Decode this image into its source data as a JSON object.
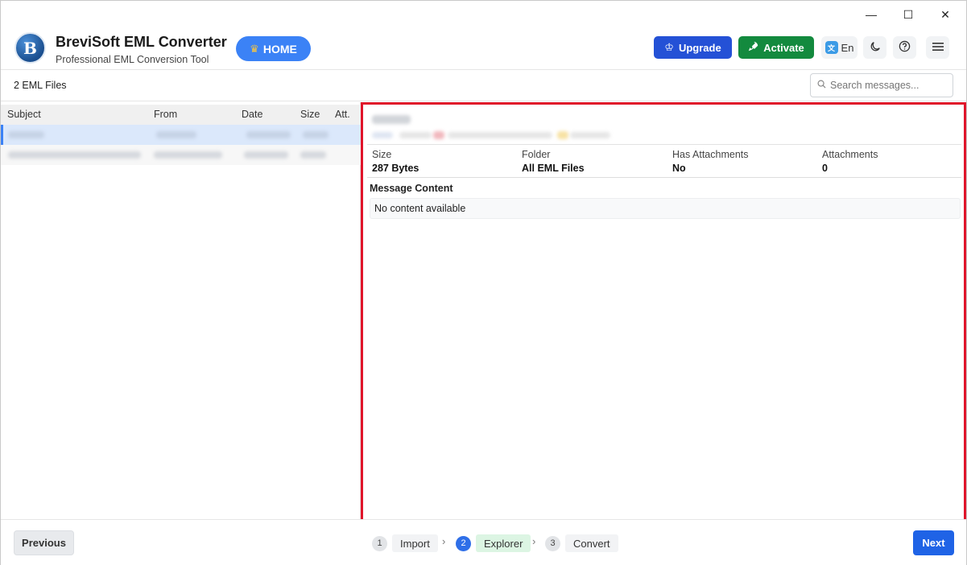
{
  "window": {
    "controls": {
      "minimize": "—",
      "maximize": "☐",
      "close": "✕"
    }
  },
  "header": {
    "logo_letter": "B",
    "title": "BreviSoft EML Converter",
    "subtitle": "Professional EML Conversion Tool",
    "home_label": "HOME",
    "upgrade_label": "Upgrade",
    "activate_label": "Activate",
    "language_label": "En",
    "colors": {
      "home": "#3b82f6",
      "upgrade": "#2451d6",
      "activate": "#138a3e"
    }
  },
  "subbar": {
    "file_count": "2 EML Files",
    "search_placeholder": "Search messages..."
  },
  "list": {
    "columns": [
      "Subject",
      "From",
      "Date",
      "Size",
      "Att."
    ]
  },
  "detail": {
    "meta": [
      {
        "label": "Size",
        "value": "287 Bytes"
      },
      {
        "label": "Folder",
        "value": "All EML Files"
      },
      {
        "label": "Has Attachments",
        "value": "No"
      },
      {
        "label": "Attachments",
        "value": "0"
      }
    ],
    "content_label": "Message Content",
    "content_value": "No content available"
  },
  "footer": {
    "previous_label": "Previous",
    "next_label": "Next",
    "steps": [
      {
        "num": "1",
        "label": "Import"
      },
      {
        "num": "2",
        "label": "Explorer"
      },
      {
        "num": "3",
        "label": "Convert"
      }
    ]
  }
}
